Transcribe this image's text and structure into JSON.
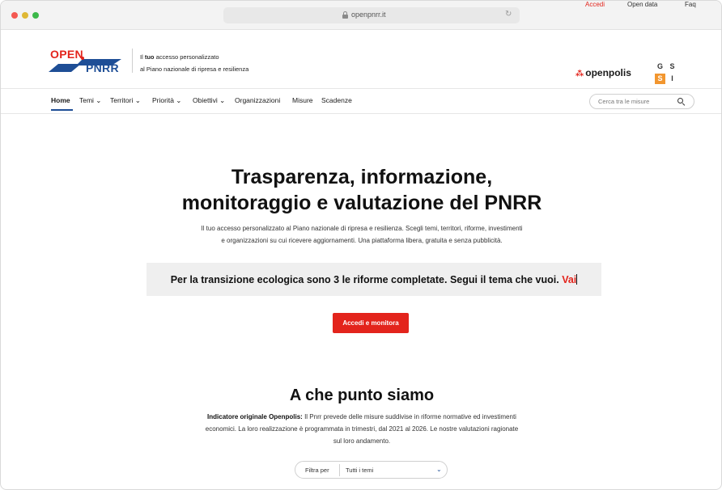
{
  "browser": {
    "url": "openpnrr.it"
  },
  "header": {
    "logo_open": "OPEN",
    "logo_pnrr": "PNRR",
    "tagline_bold": "tuo",
    "tagline_line1_pre": "Il ",
    "tagline_line1_post": " accesso personalizzato",
    "tagline_line2": "al Piano nazionale di ripresa e resilienza",
    "top_links": [
      "Accedi",
      "Open data",
      "Faq"
    ],
    "partner_name": "openpolis",
    "partner_logo_letters": [
      "G",
      "S",
      "S",
      "I"
    ]
  },
  "nav": {
    "items": [
      {
        "label": "Home",
        "active": true
      },
      {
        "label": "Temi ⌄"
      },
      {
        "label": "Territori ⌄"
      },
      {
        "label": "Priorità ⌄"
      },
      {
        "label": "Obiettivi ⌄"
      },
      {
        "label": "Organizzazioni"
      },
      {
        "label": "Misure"
      },
      {
        "label": "Scadenze"
      }
    ],
    "search_placeholder": "Cerca tra le misure"
  },
  "hero": {
    "title_line1": "Trasparenza, informazione,",
    "title_line2": "monitoraggio e valutazione del PNRR",
    "subtitle_line1": "Il tuo accesso personalizzato al Piano nazionale di ripresa e resilienza. Scegli temi, territori, riforme, investimenti",
    "subtitle_line2": "e organizzazioni su cui ricevere aggiornamenti. Una piattaforma libera, gratuita e senza pubblicità.",
    "banner_text": "Per la transizione ecologica sono 3 le riforme completate. Segui il tema che vuoi.",
    "banner_link": "Vai",
    "cta_label": "Accedi e monitora"
  },
  "section": {
    "title": "A che punto siamo",
    "text_bold": "Indicatore originale Openpolis:",
    "text_line1": " Il Pnrr prevede delle misure suddivise in riforme normative ed investimenti",
    "text_line2": "economici. La loro realizzazione è programmata in trimestri, dal 2021 al 2026. Le nostre valutazioni ragionate",
    "text_line3": "sul loro andamento.",
    "filter_label": "Filtra per",
    "filter_value": "Tutti i temi"
  },
  "colors": {
    "brand_red": "#e3241c",
    "brand_blue": "#1e4e96",
    "gssi_orange": "#f2962f"
  }
}
